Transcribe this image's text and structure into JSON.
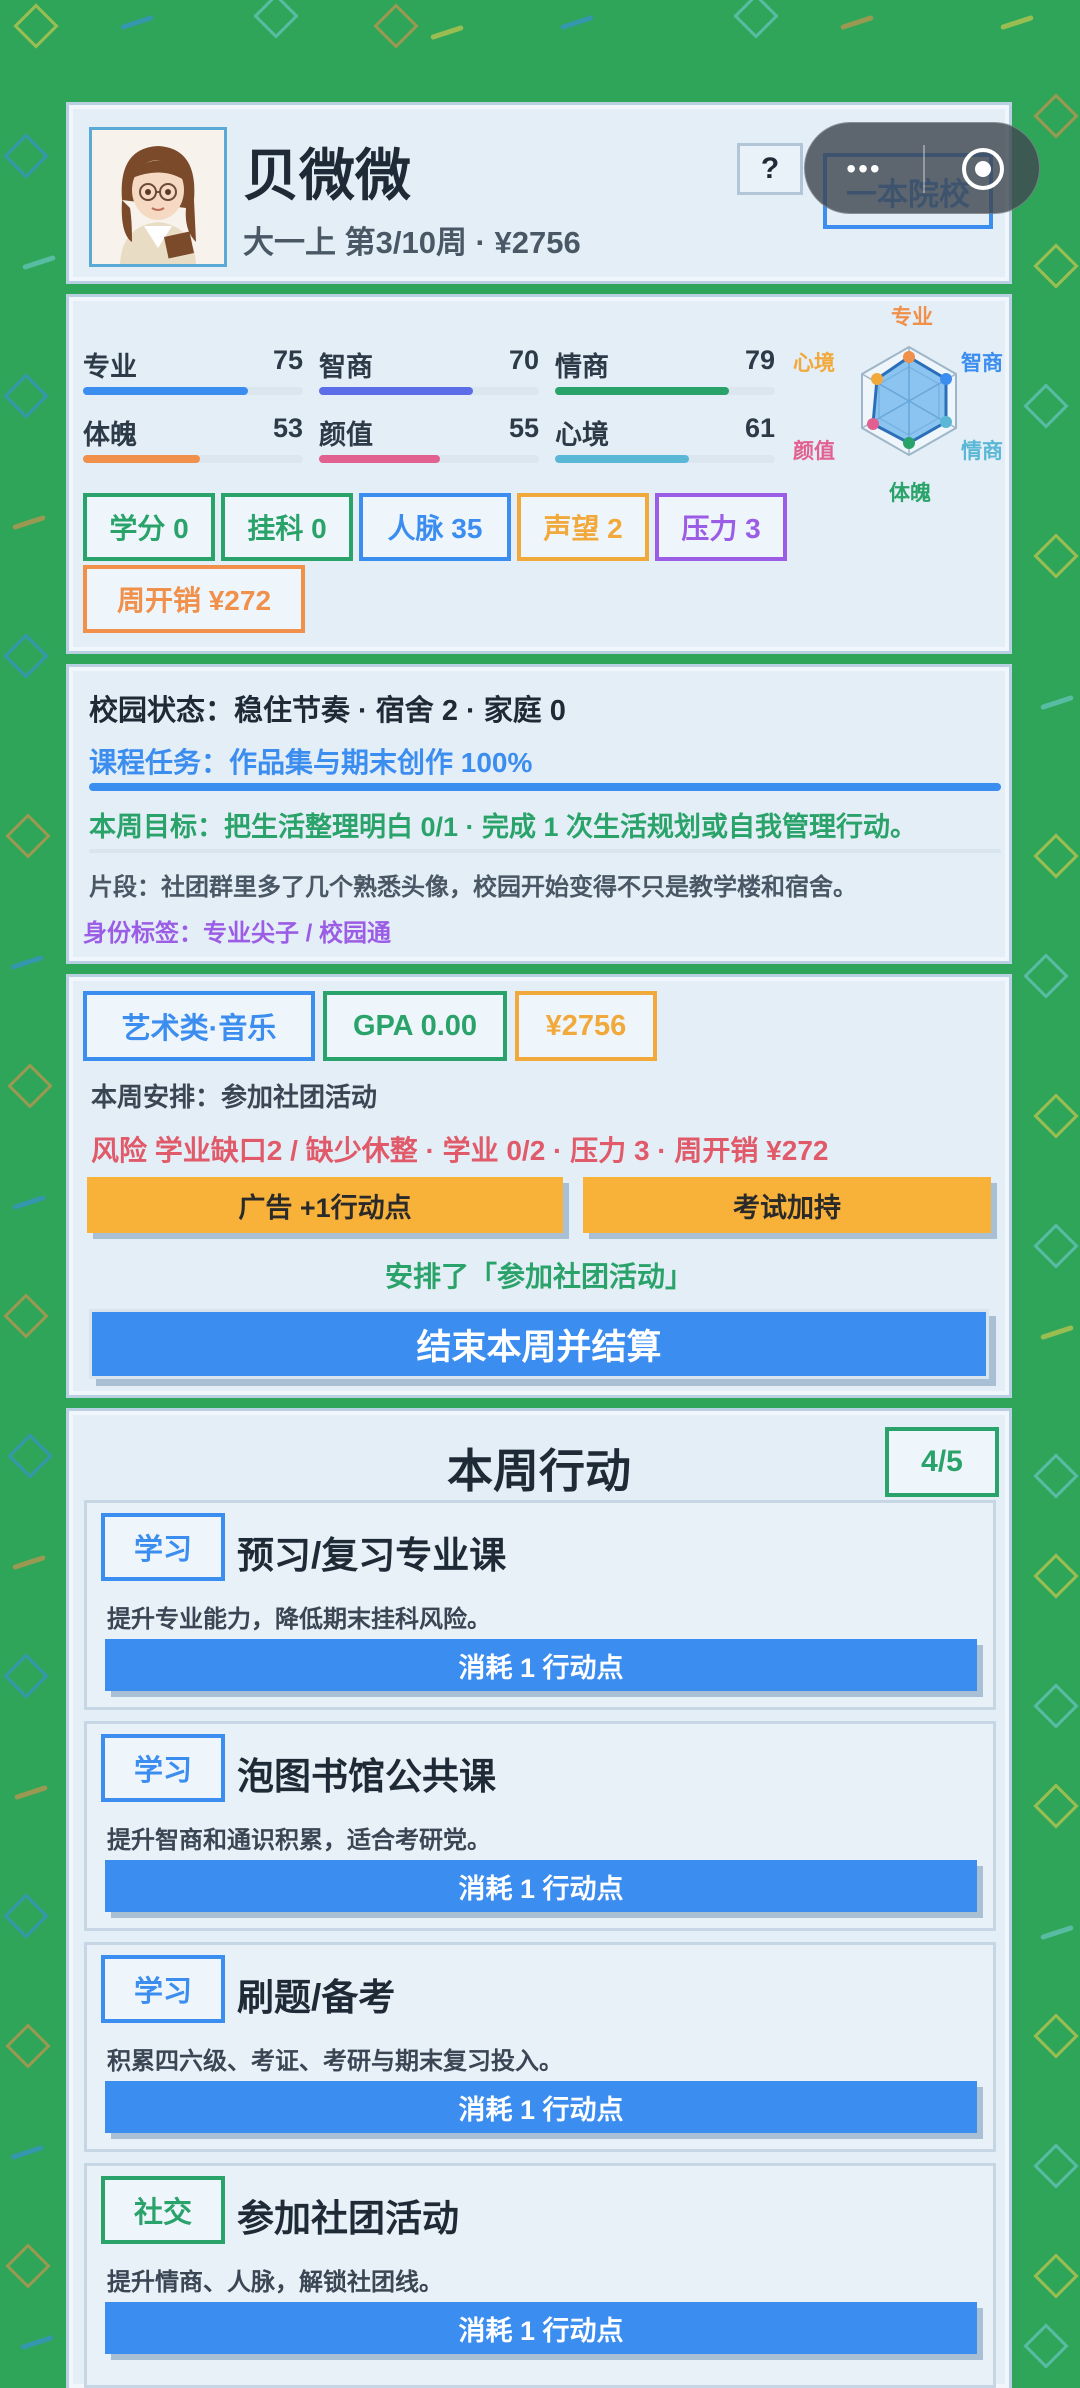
{
  "profile": {
    "name": "贝微微",
    "subtitle": "大一上 第3/10周 · ¥2756",
    "school_tier": "一本院校",
    "help_label": "?"
  },
  "miniprogram": {
    "more_label": "•••"
  },
  "stats": [
    {
      "label": "专业",
      "value": "75",
      "color": "#3b8df0",
      "fill": 0.75
    },
    {
      "label": "智商",
      "value": "70",
      "color": "#5b6ee8",
      "fill": 0.7
    },
    {
      "label": "情商",
      "value": "79",
      "color": "#2aa36a",
      "fill": 0.79
    },
    {
      "label": "体魄",
      "value": "53",
      "color": "#f0904a",
      "fill": 0.53
    },
    {
      "label": "颜值",
      "value": "55",
      "color": "#e2608f",
      "fill": 0.55
    },
    {
      "label": "心境",
      "value": "61",
      "color": "#5ab8d6",
      "fill": 0.61
    }
  ],
  "radar": {
    "labels": {
      "top": "专业",
      "top_right": "智商",
      "bottom_right": "情商",
      "bottom": "体魄",
      "bottom_left": "颜值",
      "top_left": "心境"
    }
  },
  "badges": [
    {
      "label": "学分 0",
      "color": "#2aa36a"
    },
    {
      "label": "挂科 0",
      "color": "#2aa36a"
    },
    {
      "label": "人脉 35",
      "color": "#3b8df0"
    },
    {
      "label": "声望 2",
      "color": "#f2a93b"
    },
    {
      "label": "压力 3",
      "color": "#9b5de5"
    },
    {
      "label": "周开销 ¥272",
      "color": "#f0904a"
    }
  ],
  "status": {
    "campus": "校园状态：稳住节奏 · 宿舍 2 · 家庭 0",
    "course_task": "课程任务：作品集与期末创作 100%",
    "course_progress": 1.0,
    "weekly_goal": "本周目标：把生活整理明白 0/1 · 完成 1 次生活规划或自我管理行动。",
    "fragment": "片段：社团群里多了几个熟悉头像，校园开始变得不只是教学楼和宿舍。",
    "identity": "身份标签：专业尖子 / 校园通"
  },
  "week": {
    "major_tag": "艺术类·音乐",
    "gpa_tag": "GPA 0.00",
    "money_tag": "¥2756",
    "schedule": "本周安排：参加社团活动",
    "risk": "风险 学业缺口2 / 缺少休整 · 学业 0/2 · 压力 3 · 周开销 ¥272",
    "ad_button": "广告 +1行动点",
    "exam_button": "考试加持",
    "arranged": "安排了「参加社团活动」",
    "end_button": "结束本周并结算"
  },
  "actions_panel": {
    "title": "本周行动",
    "counter": "4/5",
    "items": [
      {
        "tag": "学习",
        "tag_color": "#3b8df0",
        "title": "预习/复习专业课",
        "desc": "提升专业能力，降低期末挂科风险。",
        "button": "消耗 1 行动点"
      },
      {
        "tag": "学习",
        "tag_color": "#3b8df0",
        "title": "泡图书馆公共课",
        "desc": "提升智商和通识积累，适合考研党。",
        "button": "消耗 1 行动点"
      },
      {
        "tag": "学习",
        "tag_color": "#3b8df0",
        "title": "刷题/备考",
        "desc": "积累四六级、考证、考研与期末复习投入。",
        "button": "消耗 1 行动点"
      },
      {
        "tag": "社交",
        "tag_color": "#2aa36a",
        "title": "参加社团活动",
        "desc": "提升情商、人脉，解锁社团线。",
        "button": "消耗 1 行动点"
      }
    ]
  }
}
